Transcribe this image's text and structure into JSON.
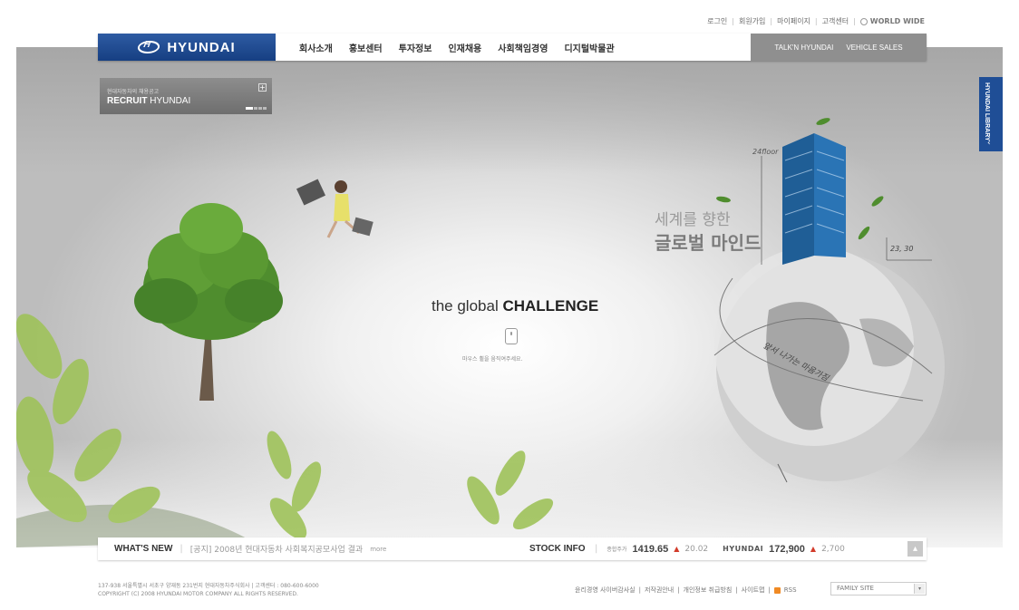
{
  "util_links": [
    "로그인",
    "회원가입",
    "마이페이지",
    "고객센터"
  ],
  "world_wide": "WORLD WIDE",
  "brand": "HYUNDAI",
  "nav_menu": [
    "회사소개",
    "홍보센터",
    "투자정보",
    "인재채용",
    "사회책임경영",
    "디지털박물관"
  ],
  "nav_right": [
    "TALK'N HYUNDAI",
    "VEHICLE SALES"
  ],
  "side_tab": {
    "label": "HYUNDAI LIBRARY",
    "arrow": "‹"
  },
  "recruit": {
    "small": "현대자동차의 채용공고",
    "bold": "RECRUIT",
    "rest": " HYUNDAI",
    "plus": "+"
  },
  "hero": {
    "headline_light": "the global ",
    "headline_bold": "CHALLENGE",
    "hint": "마우스 휠을 움직여주세요.",
    "kor_line1": "세계를 향한",
    "kor_line2": "글로벌 마인드",
    "hand1": "24floor",
    "hand2": "23, 30",
    "hand3": "앞서 나가는 마음가짐"
  },
  "whats_new": {
    "title": "WHAT'S NEW",
    "text": "[공지] 2008년 현대자동차 사회복지공모사업 결과",
    "more": "more"
  },
  "stock": {
    "title": "STOCK INFO",
    "index_label": "종합주가",
    "index_value": "1419.65",
    "index_change": "20.02",
    "company": "HYUNDAI",
    "company_value": "172,900",
    "company_change": "2,700",
    "up_mark": "▲"
  },
  "footer": {
    "line1": "137-938 서울특별시 서초구 양재동 231번지 현대자동차주식회사 | 고객센터 : 080-600-6000",
    "line2": "COPYRIGHT (C) 2008 HYUNDAI MOTOR COMPANY ALL RIGHTS RESERVED.",
    "links": [
      "윤리경영 사이버감사실",
      "저작권안내",
      "개인정보 취급방침",
      "사이트맵"
    ],
    "rss": "RSS",
    "family_site": "FAMILY SITE"
  },
  "colors": {
    "brand_blue": "#1f4e96",
    "up_red": "#d23b2a"
  }
}
